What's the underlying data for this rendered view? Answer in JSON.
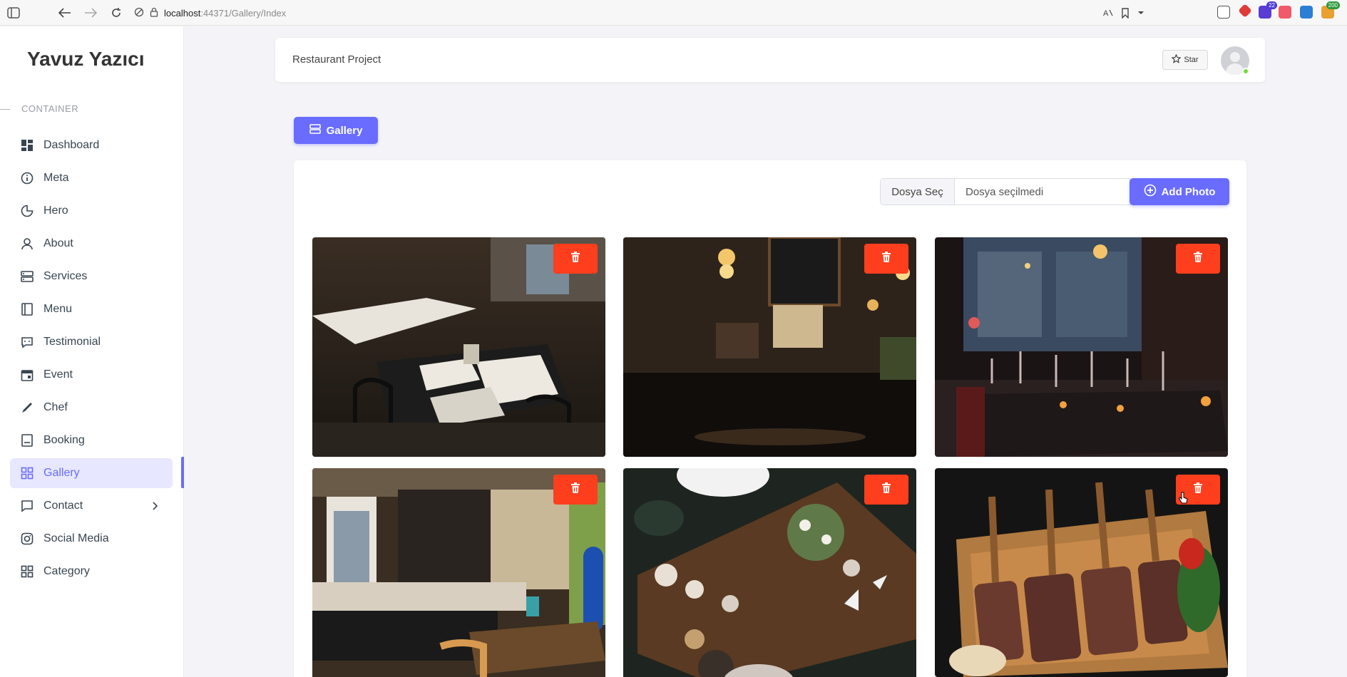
{
  "browser": {
    "url_host": "localhost",
    "url_path": ":44371/Gallery/Index",
    "extension_badges": [
      "22",
      "200"
    ]
  },
  "sidebar": {
    "brand": "Yavuz Yazıcı",
    "section": "CONTAINER",
    "items": [
      {
        "label": "Dashboard",
        "icon": "dashboard-icon"
      },
      {
        "label": "Meta",
        "icon": "info-icon"
      },
      {
        "label": "Hero",
        "icon": "pie-icon"
      },
      {
        "label": "About",
        "icon": "user-icon"
      },
      {
        "label": "Services",
        "icon": "server-icon"
      },
      {
        "label": "Menu",
        "icon": "book-icon"
      },
      {
        "label": "Testimonial",
        "icon": "chat-icon"
      },
      {
        "label": "Event",
        "icon": "calendar-icon"
      },
      {
        "label": "Chef",
        "icon": "pen-icon"
      },
      {
        "label": "Booking",
        "icon": "booking-icon"
      },
      {
        "label": "Gallery",
        "icon": "grid-icon",
        "active": true
      },
      {
        "label": "Contact",
        "icon": "message-icon",
        "has_submenu": true
      },
      {
        "label": "Social Media",
        "icon": "instagram-icon"
      },
      {
        "label": "Category",
        "icon": "category-icon"
      }
    ]
  },
  "topbar": {
    "title": "Restaurant Project",
    "star_label": "Star"
  },
  "page": {
    "header_button": "Gallery"
  },
  "upload": {
    "choose_label": "Dosya Seç",
    "no_file_text": "Dosya seçilmedi",
    "add_button": "Add Photo"
  },
  "colors": {
    "primary": "#696cff",
    "danger": "#ff3e1d",
    "online": "#71dd37"
  },
  "gallery": {
    "photos": [
      {
        "subject": "restaurant-tables"
      },
      {
        "subject": "bar-interior"
      },
      {
        "subject": "dining-table-glasses"
      },
      {
        "subject": "cafe-counter"
      },
      {
        "subject": "overhead-table"
      },
      {
        "subject": "grilled-meat"
      }
    ]
  }
}
